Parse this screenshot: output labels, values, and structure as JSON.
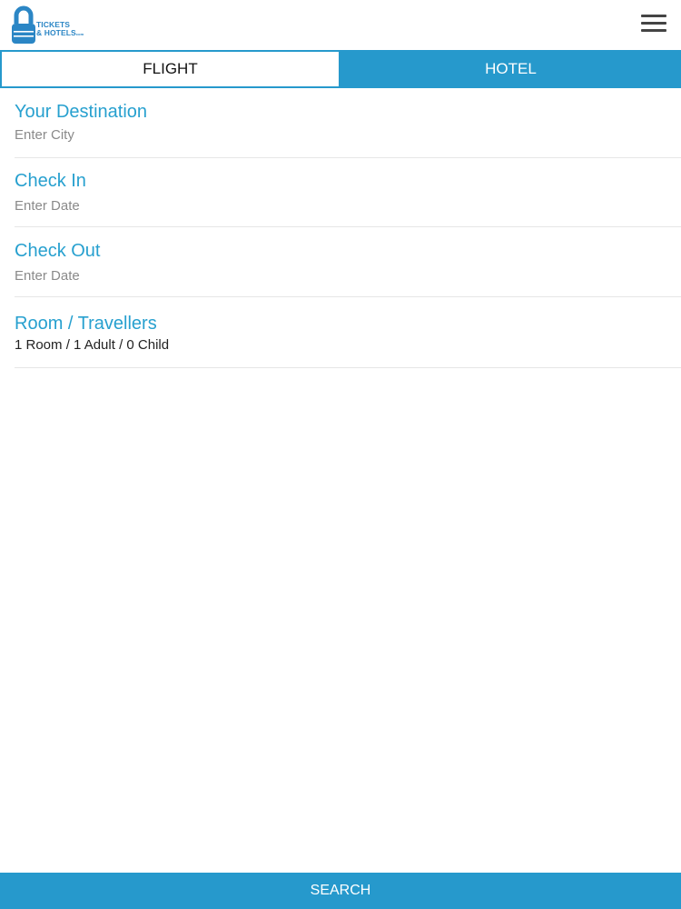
{
  "app": {
    "logo": {
      "line1": "TICKETS",
      "line2": "& HOTELS",
      "suffix": "com"
    },
    "menu_icon": "hamburger-menu-icon"
  },
  "tabs": [
    {
      "label": "FLIGHT",
      "active": true
    },
    {
      "label": "HOTEL",
      "active": false
    }
  ],
  "form": {
    "destination": {
      "label": "Your Destination",
      "placeholder": "Enter City"
    },
    "check_in": {
      "label": "Check In",
      "placeholder": "Enter Date"
    },
    "check_out": {
      "label": "Check Out",
      "placeholder": "Enter Date"
    },
    "rooms": {
      "label": "Room / Travellers",
      "value": "1 Room / 1 Adult / 0 Child"
    }
  },
  "search": {
    "label": "SEARCH"
  },
  "colors": {
    "accent": "#2699cc",
    "label": "#27a0cf",
    "placeholder": "#8a8a8a"
  }
}
